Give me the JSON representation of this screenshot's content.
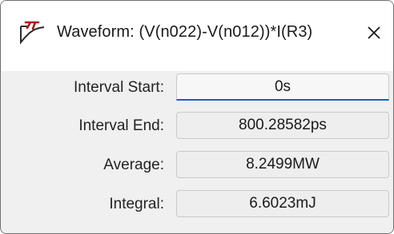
{
  "window": {
    "title": "Waveform: (V(n022)-V(n012))*I(R3)",
    "app_icon": "ltspice-logo-icon",
    "close_icon": "close-icon"
  },
  "fields": [
    {
      "label": "Interval Start:",
      "value": "0s"
    },
    {
      "label": "Interval End:",
      "value": "800.28582ps"
    },
    {
      "label": "Average:",
      "value": "8.2499MW"
    },
    {
      "label": "Integral:",
      "value": "6.6023mJ"
    }
  ],
  "colors": {
    "focus_underline": "#0a63c9",
    "icon_red": "#b01818"
  }
}
